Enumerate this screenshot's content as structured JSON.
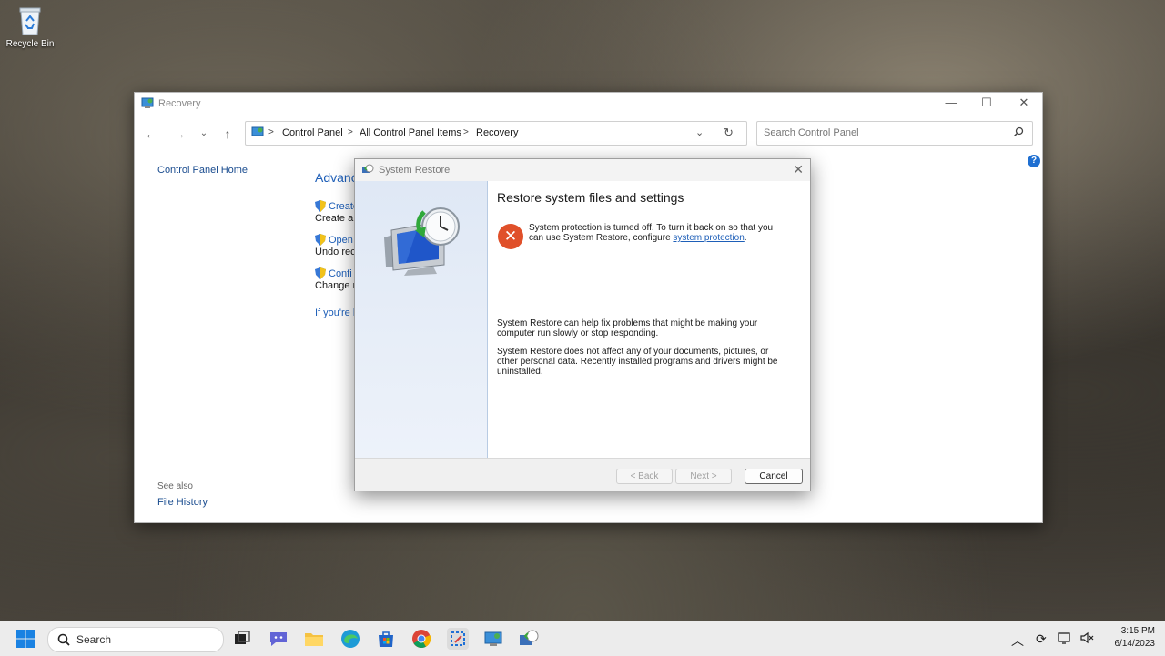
{
  "desktop": {
    "recycle_bin_label": "Recycle Bin"
  },
  "window": {
    "title": "Recovery",
    "breadcrumbs": [
      "Control Panel",
      "All Control Panel Items",
      "Recovery"
    ],
    "search_placeholder": "Search Control Panel",
    "left_nav": {
      "home": "Control Panel Home",
      "see_also": "See also",
      "file_history": "File History"
    },
    "main": {
      "heading_partial": "Advanc",
      "items": [
        {
          "link": "Create",
          "desc": "Create a r"
        },
        {
          "link": "Open",
          "desc": "Undo rec"
        },
        {
          "link": "Confi",
          "desc": "Change r"
        }
      ],
      "footer_link_partial": "If you're h"
    }
  },
  "dialog": {
    "title": "System Restore",
    "heading": "Restore system files and settings",
    "warning_text": "System protection is turned off. To turn it back on so that you can use System Restore, configure",
    "warning_link": "system protection",
    "warning_end": ".",
    "para1": "System Restore can help fix problems that might be making your computer run slowly or stop responding.",
    "para2": "System Restore does not affect any of your documents, pictures, or other personal data. Recently installed programs and drivers might be uninstalled.",
    "buttons": {
      "back": "< Back",
      "next": "Next >",
      "cancel": "Cancel"
    }
  },
  "taskbar": {
    "search_label": "Search",
    "time": "3:15 PM",
    "date": "6/14/2023"
  }
}
